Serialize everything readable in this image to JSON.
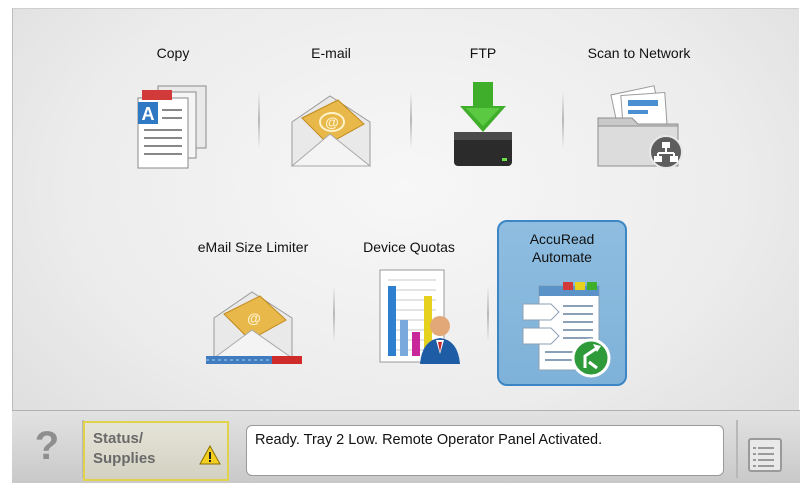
{
  "tiles": {
    "copy": "Copy",
    "email": "E-mail",
    "ftp": "FTP",
    "scan_to_network": "Scan to Network",
    "email_size_limiter": "eMail Size Limiter",
    "device_quotas": "Device Quotas",
    "accuread": "AccuRead\nAutomate"
  },
  "selected_tile": "AccuRead Automate",
  "bottom_bar": {
    "help_label": "?",
    "status_label": "Status/\nSupplies",
    "status_message": "Ready. Tray 2 Low. Remote Operator Panel Activated."
  },
  "icons": {
    "copy": "copy-documents-icon",
    "email": "envelope-icon",
    "ftp": "ftp-drive-icon",
    "scan_to_network": "network-folder-icon",
    "email_size_limiter": "envelope-size-limit-icon",
    "device_quotas": "quota-chart-icon",
    "accuread": "workflow-icon",
    "warning": "warning-icon",
    "menu": "menu-list-icon"
  },
  "colors": {
    "selected_tile": "#8ebde0",
    "warning": "#f2cf1f",
    "ftp_arrow": "#3fae2a"
  }
}
